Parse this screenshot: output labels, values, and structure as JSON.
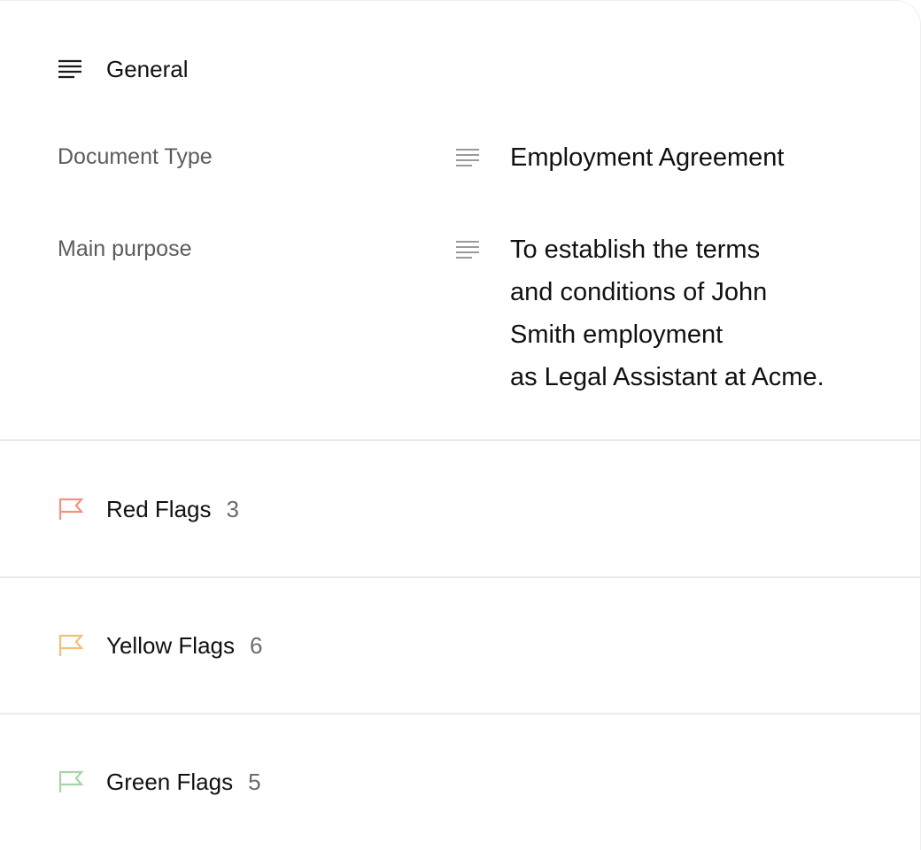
{
  "general": {
    "title": "General",
    "icon": "align-left-icon",
    "fields": [
      {
        "label": "Document Type",
        "icon": "align-left-icon",
        "value_lines": [
          "Employment Agreement"
        ]
      },
      {
        "label": "Main purpose",
        "icon": "align-left-icon",
        "value_lines": [
          "To establish the terms",
          "and conditions of John",
          "Smith employment",
          "as Legal Assistant at Acme."
        ]
      }
    ]
  },
  "flags": [
    {
      "label": "Red Flags",
      "count": "3",
      "icon": "flag-icon",
      "color": "#F2937A"
    },
    {
      "label": "Yellow Flags",
      "count": "6",
      "icon": "flag-icon",
      "color": "#F5BE77"
    },
    {
      "label": "Green Flags",
      "count": "5",
      "icon": "flag-icon",
      "color": "#A7D3A9"
    }
  ]
}
